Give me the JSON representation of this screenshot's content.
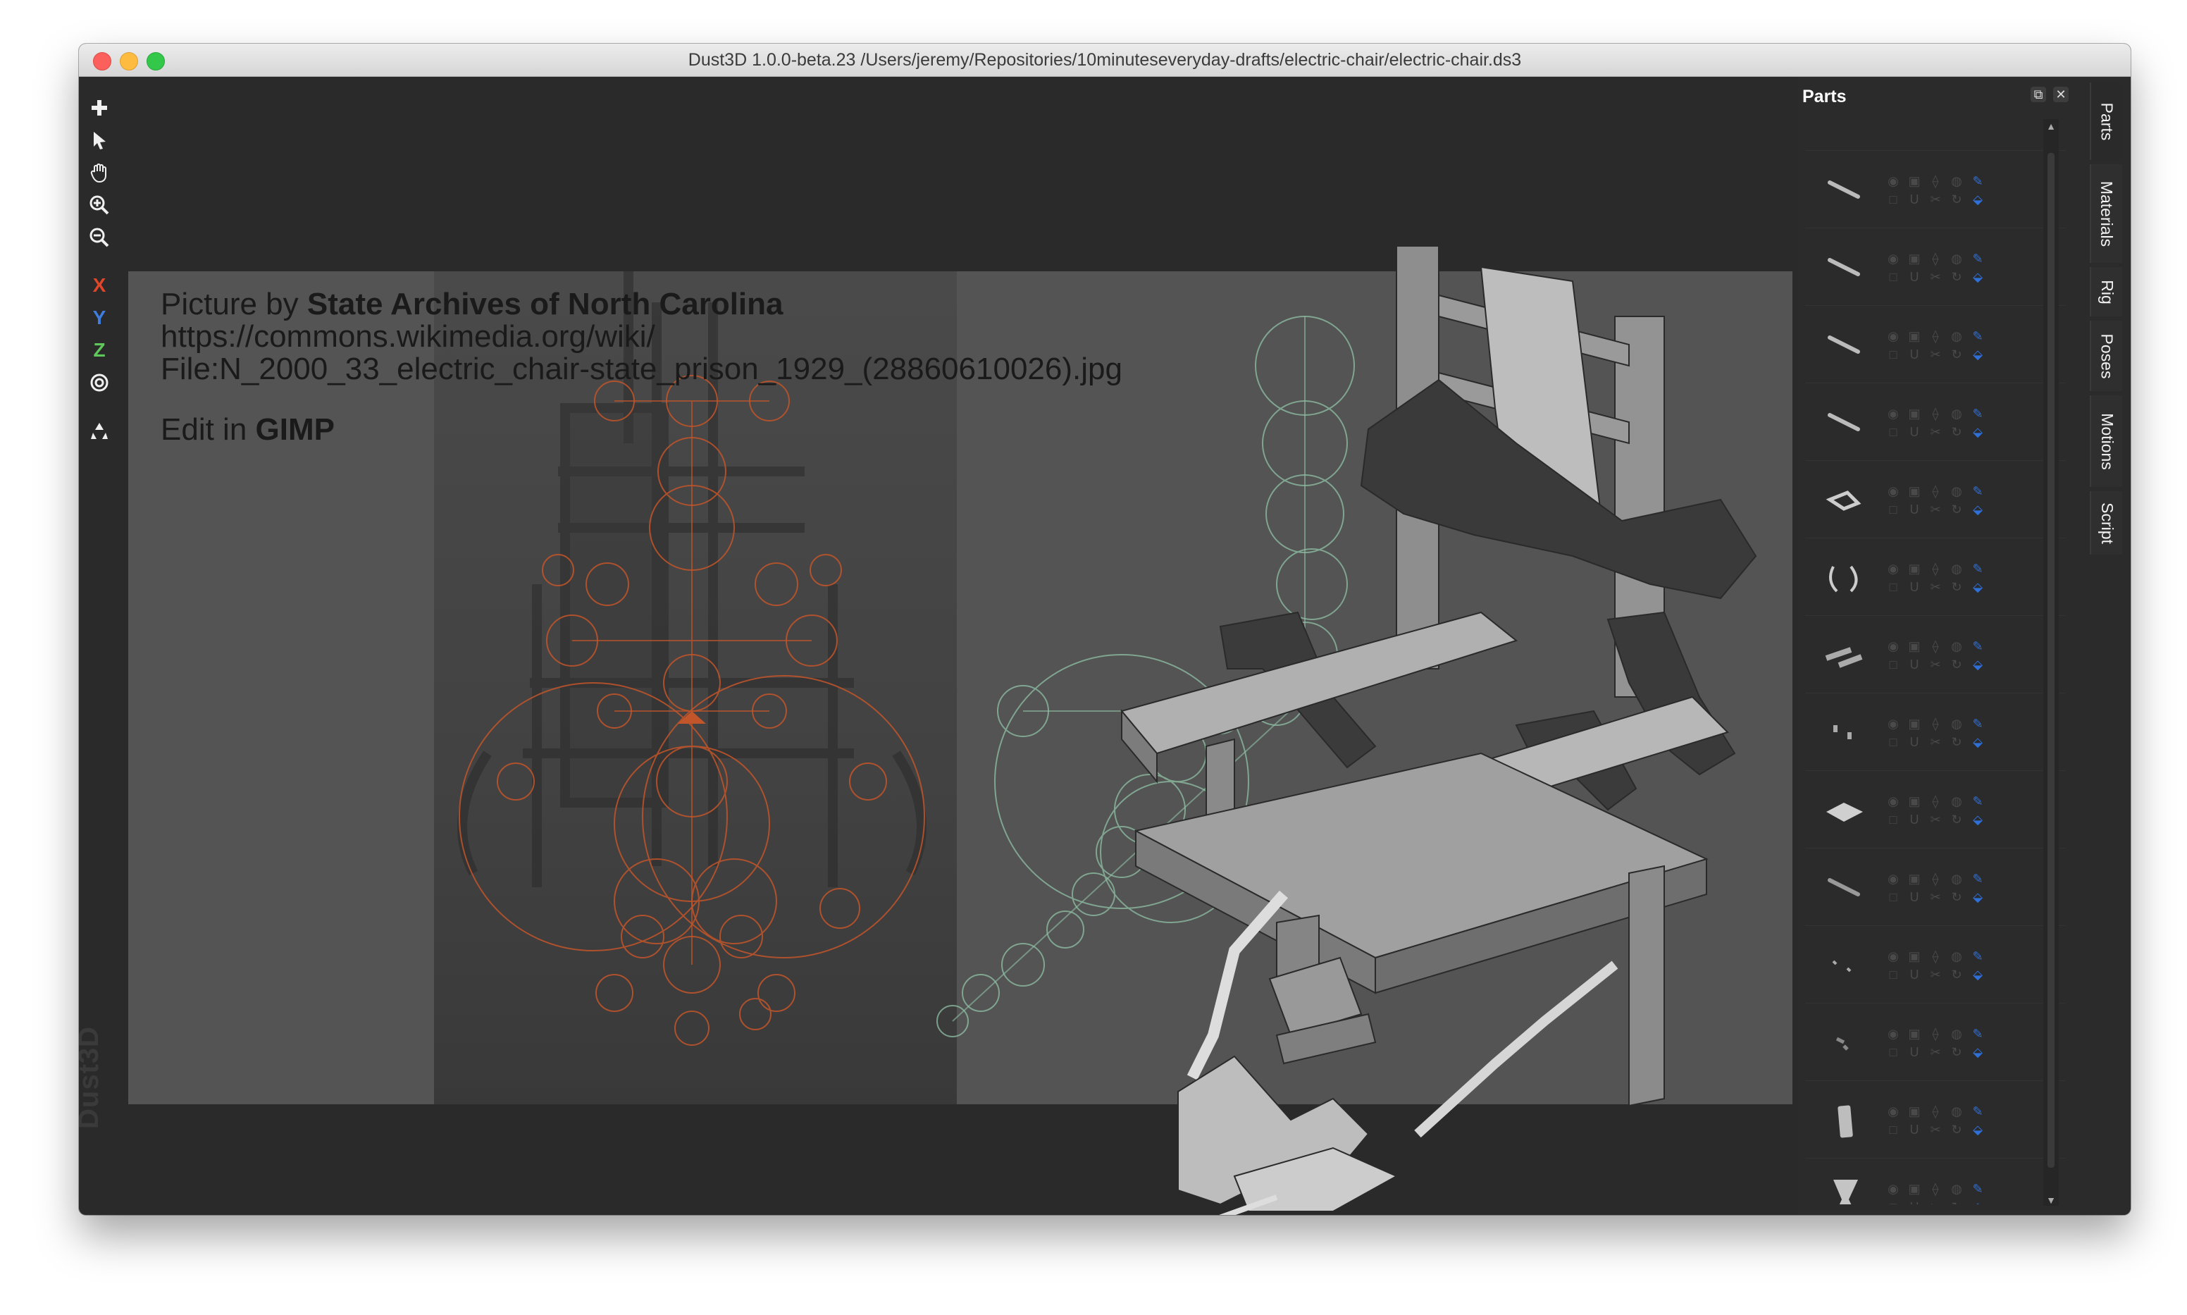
{
  "window": {
    "title": "Dust3D 1.0.0-beta.23 /Users/jeremy/Repositories/10minuteseveryday-drafts/electric-chair/electric-chair.ds3"
  },
  "toolbar": {
    "tools": [
      {
        "name": "add-icon"
      },
      {
        "name": "select-pointer-icon"
      },
      {
        "name": "hand-drag-icon"
      },
      {
        "name": "zoom-in-icon"
      },
      {
        "name": "zoom-out-icon"
      }
    ],
    "axes": {
      "x": "X",
      "y": "Y",
      "z": "Z"
    },
    "radial_icon": "radial-target-icon",
    "recycle_icon": "recycle-icon"
  },
  "brand": "Dust3D",
  "caption": {
    "line1_prefix": "Picture by ",
    "line1_bold": "State Archives of North Carolina",
    "line2": "https://commons.wikimedia.org/wiki/",
    "line3": "File:N_2000_33_electric_chair-state_prison_1929_(28860610026).jpg",
    "line4_prefix": "Edit in ",
    "line4_bold": "GIMP"
  },
  "parts_panel": {
    "title": "Parts",
    "float_icon": "float-window-icon",
    "close_icon": "close-icon",
    "rows": 14
  },
  "side_tabs": [
    "Parts",
    "Materials",
    "Rig",
    "Poses",
    "Motions",
    "Script"
  ],
  "colors": {
    "accent_blue": "#2f6fd8",
    "axis_x": "#e0462a",
    "axis_y": "#3d7ee0",
    "axis_z": "#5fc85a",
    "node_orange": "#c2552a",
    "node_green": "#8fc0a6"
  }
}
